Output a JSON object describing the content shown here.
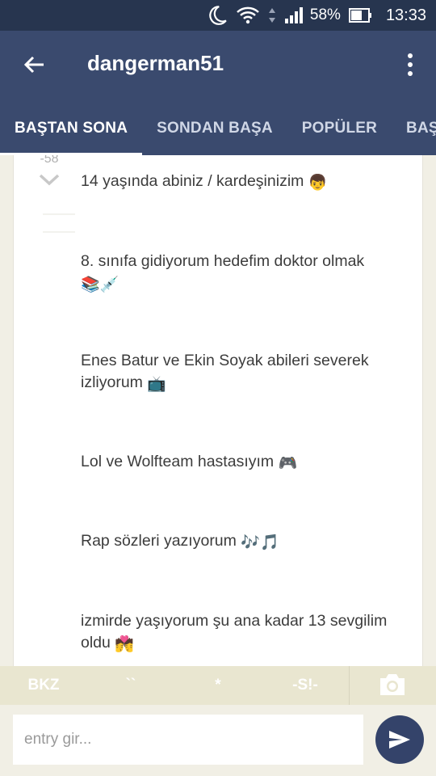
{
  "status_bar": {
    "battery_percent": "58%",
    "time": "13:33"
  },
  "header": {
    "title": "dangerman51"
  },
  "tabs": [
    {
      "label": "BAŞTAN SONA",
      "active": true
    },
    {
      "label": "SONDAN BAŞA",
      "active": false
    },
    {
      "label": "POPÜLER",
      "active": false
    },
    {
      "label": "BAŞ",
      "active": false
    }
  ],
  "entry": {
    "vote_count": "-58",
    "lines": [
      {
        "text": "14 yaşında abiniz / kardeşinizim",
        "emoji": "👦"
      },
      {
        "text": "8. sınıfa gidiyorum hedefim doktor olmak",
        "emoji": "📚💉"
      },
      {
        "text": "Enes Batur ve Ekin Soyak abileri severek izliyorum",
        "emoji": "📺"
      },
      {
        "text": "Lol ve Wolfteam hastasıyım",
        "emoji": "🎮"
      },
      {
        "text": "Rap sözleri yazıyorum",
        "emoji": "🎶🎵"
      },
      {
        "text": "izmirde yaşıyorum şu ana kadar 13 sevgilim oldu",
        "emoji": "💏"
      }
    ]
  },
  "toolbar": {
    "bkz": "BKZ",
    "backtick": "``",
    "star": "*",
    "spoiler": "-S!-"
  },
  "input": {
    "placeholder": "entry gir..."
  },
  "colors": {
    "app_bar": "#3a4a6e",
    "status_bar": "#27354f",
    "send_button": "#34436a",
    "toolbar": "#e9e6d0"
  }
}
